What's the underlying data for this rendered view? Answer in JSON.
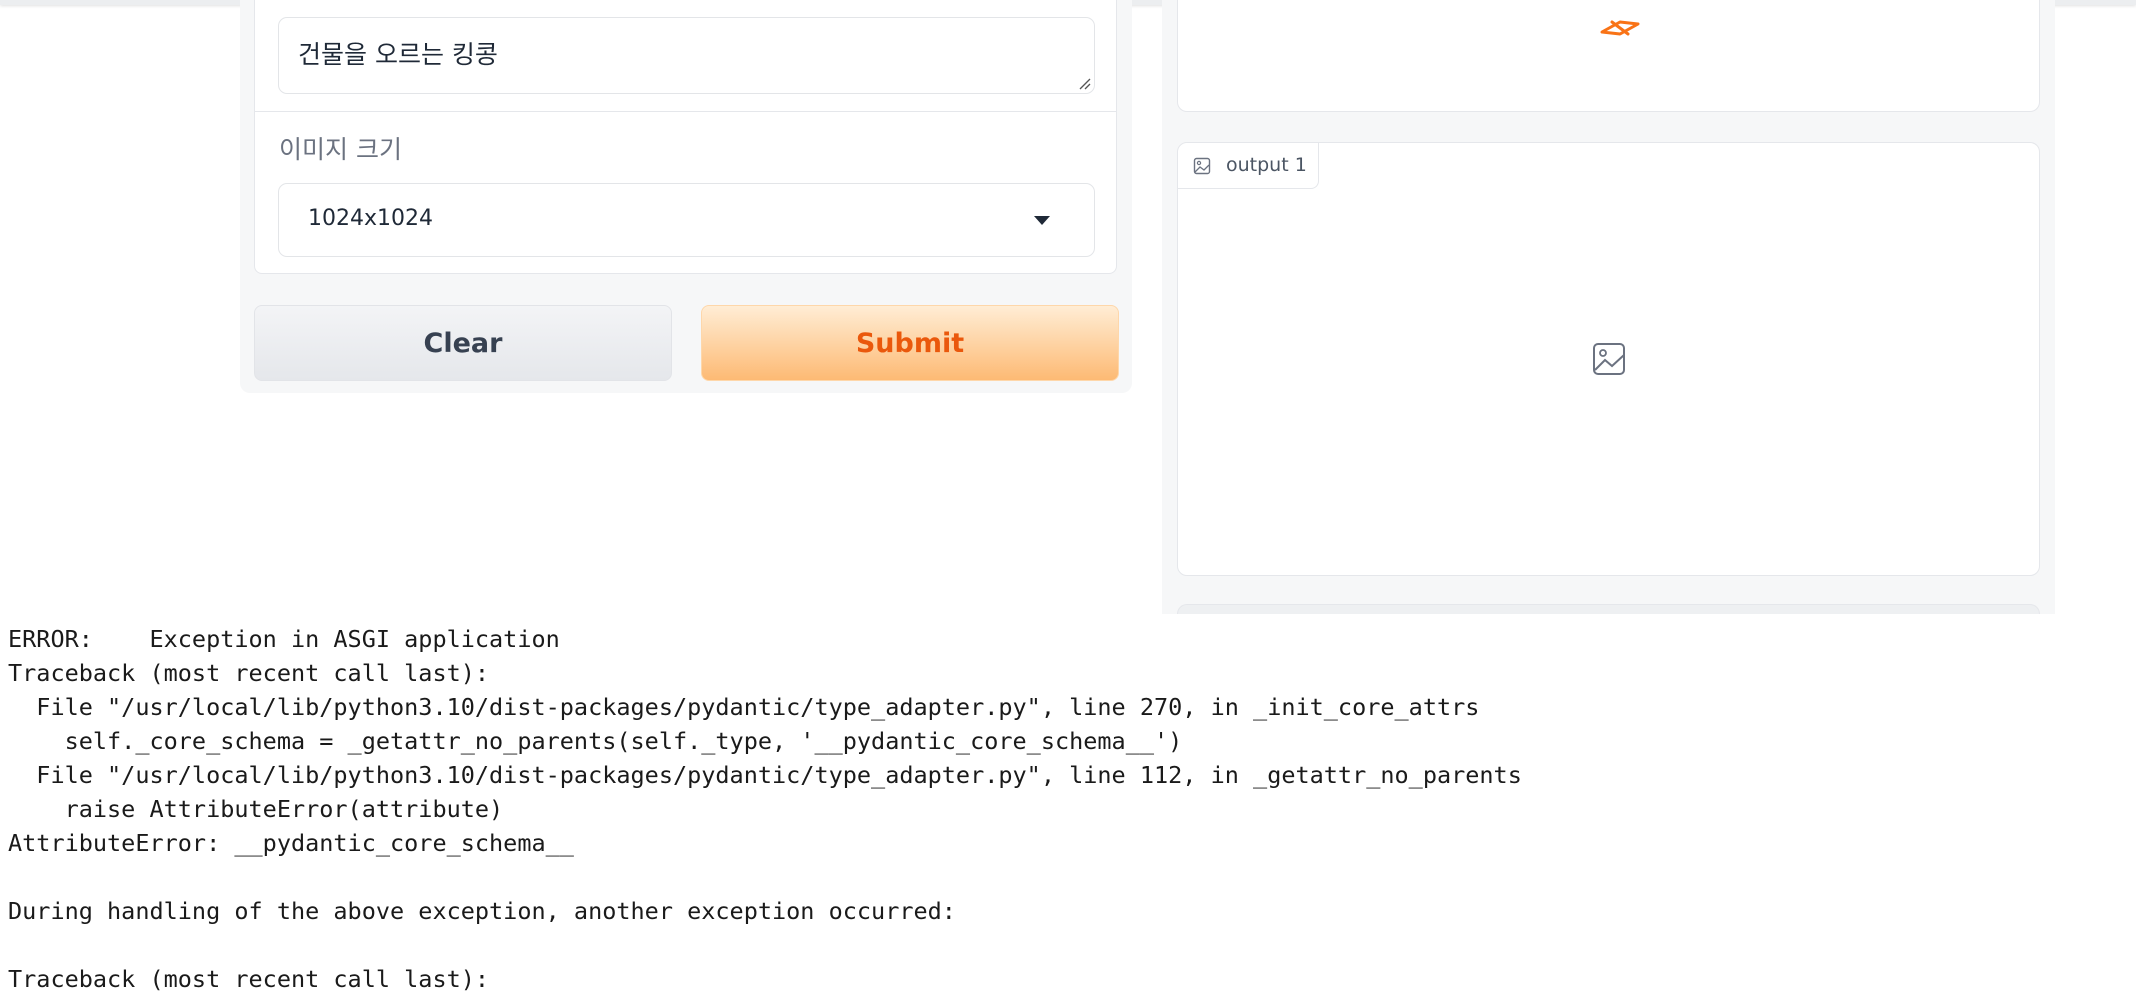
{
  "form": {
    "prompt_value": "건물을 오르는 킹콩",
    "size_label": "이미지 크기",
    "size_selected": "1024x1024",
    "clear_label": "Clear",
    "submit_label": "Submit"
  },
  "output": {
    "tab_label": "output 1"
  },
  "colors": {
    "accent": "#ea580c",
    "submit_gradient_start": "#ffedd5",
    "submit_gradient_end": "#fdba74"
  },
  "icons": {
    "loading": "loading-spinner-icon",
    "output_tab": "image-icon",
    "output_placeholder": "image-icon"
  },
  "terminal": {
    "lines": [
      "ERROR:    Exception in ASGI application",
      "Traceback (most recent call last):",
      "  File \"/usr/local/lib/python3.10/dist-packages/pydantic/type_adapter.py\", line 270, in _init_core_attrs",
      "    self._core_schema = _getattr_no_parents(self._type, '__pydantic_core_schema__')",
      "  File \"/usr/local/lib/python3.10/dist-packages/pydantic/type_adapter.py\", line 112, in _getattr_no_parents",
      "    raise AttributeError(attribute)",
      "AttributeError: __pydantic_core_schema__",
      "",
      "During handling of the above exception, another exception occurred:",
      "",
      "Traceback (most recent call last):"
    ]
  }
}
